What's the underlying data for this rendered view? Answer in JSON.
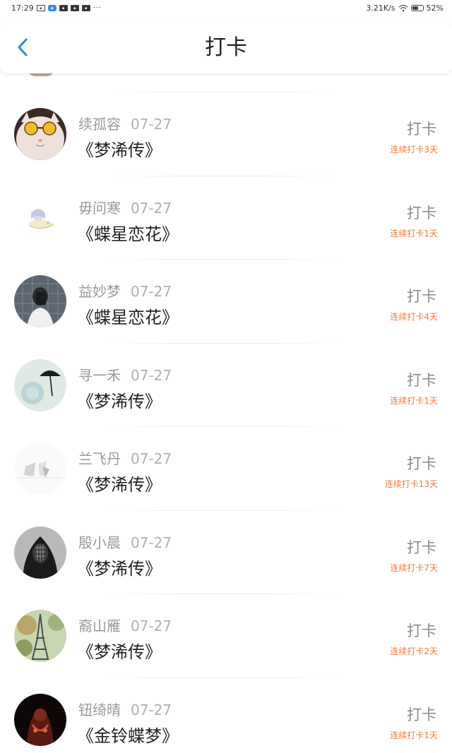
{
  "status_bar": {
    "time": "17:29",
    "notification_icons": [
      "notification-icon",
      "app-icon",
      "notification-icon",
      "notification-icon",
      "notification-icon"
    ],
    "more": "···",
    "net_speed": "3.21K/s",
    "battery": "52%"
  },
  "header": {
    "title": "打卡",
    "back_icon": "chevron-left-icon"
  },
  "colors": {
    "accent": "#2b8ad9",
    "streak": "#ef7a3a",
    "name": "#9a9a9a"
  },
  "entries": [
    {
      "name": "续孤容",
      "date": "07-27",
      "book": "《梦浠传》",
      "action": "打卡",
      "streak": "连续打卡3天",
      "avatar": "cat-glasses-avatar"
    },
    {
      "name": "毋问寒",
      "date": "07-27",
      "book": "《蝶星恋花》",
      "action": "打卡",
      "streak": "连续打卡1天",
      "avatar": "anime-girl-avatar"
    },
    {
      "name": "益妙梦",
      "date": "07-27",
      "book": "《蝶星恋花》",
      "action": "打卡",
      "streak": "连续打卡4天",
      "avatar": "mirror-selfie-avatar"
    },
    {
      "name": "寻一禾",
      "date": "07-27",
      "book": "《梦浠传》",
      "action": "打卡",
      "streak": "连续打卡1天",
      "avatar": "umbrella-rose-avatar"
    },
    {
      "name": "兰飞丹",
      "date": "07-27",
      "book": "《梦浠传》",
      "action": "打卡",
      "streak": "连续打卡13天",
      "avatar": "paper-sketch-avatar"
    },
    {
      "name": "殷小晨",
      "date": "07-27",
      "book": "《梦浠传》",
      "action": "打卡",
      "streak": "连续打卡7天",
      "avatar": "hooded-figure-avatar"
    },
    {
      "name": "裔山雁",
      "date": "07-27",
      "book": "《梦浠传》",
      "action": "打卡",
      "streak": "连续打卡2天",
      "avatar": "eiffel-tower-avatar"
    },
    {
      "name": "钮绮晴",
      "date": "07-27",
      "book": "《金铃蝶梦》",
      "action": "打卡",
      "streak": "连续打卡1天",
      "avatar": "dark-portrait-avatar"
    }
  ]
}
